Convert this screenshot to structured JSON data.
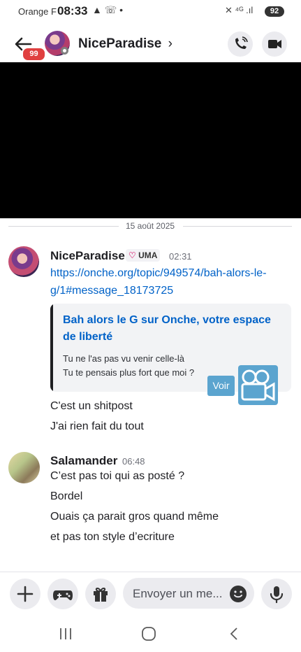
{
  "status_bar": {
    "carrier": "Orange F",
    "time": "08:33",
    "icons_left": "▲ ☏ •",
    "icons_right": "✕ ⁴ᴳ .ıl",
    "battery": "92"
  },
  "header": {
    "unread_badge": "99",
    "channel_name": "NiceParadise",
    "chevron": "›"
  },
  "date_divider": "15 août 2025",
  "messages": [
    {
      "author": "NiceParadise",
      "tag": "UMA",
      "time": "02:31",
      "link": "https://onche.org/topic/949574/bah-alors-le-g/1#message_18173725",
      "embed": {
        "title": "Bah alors le G sur Onche, votre espace de liberté",
        "line1": "Tu ne l'as pas vu venir celle-là",
        "line2": "Tu te pensais plus fort que moi ?",
        "button": "Voir"
      },
      "lines": [
        "C'est un shitpost",
        "J'ai rien fait du tout"
      ]
    },
    {
      "author": "Salamander",
      "time": "06:48",
      "lines": [
        "C’est pas toi qui as posté ?",
        "Bordel",
        "Ouais ça parait gros quand même",
        "et pas ton style d’ecriture"
      ]
    }
  ],
  "composer": {
    "placeholder": "Envoyer un me..."
  }
}
